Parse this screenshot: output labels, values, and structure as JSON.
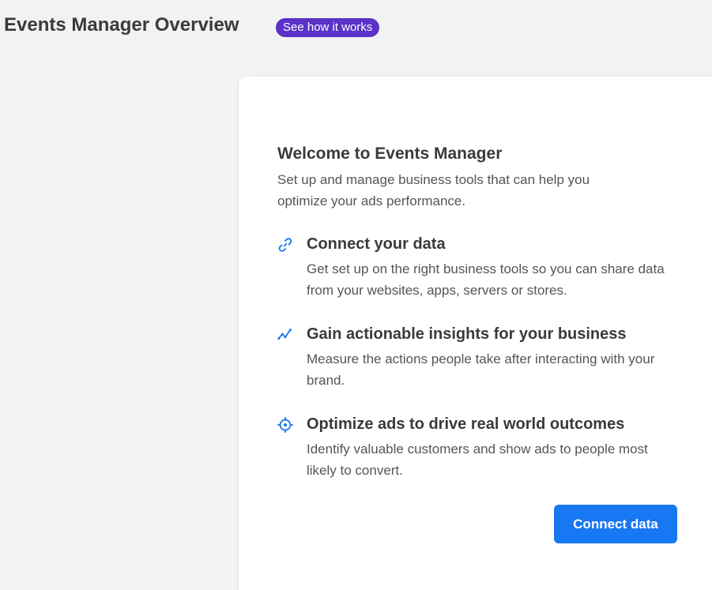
{
  "header": {
    "title": "Events Manager Overview",
    "how_it_works_label": "See how it works"
  },
  "card": {
    "title": "Welcome to Events Manager",
    "description": "Set up and manage business tools that can help you optimize your ads performance.",
    "features": [
      {
        "icon": "link-icon",
        "title": "Connect your data",
        "description": "Get set up on the right business tools so you can share data from your websites, apps, servers or stores."
      },
      {
        "icon": "chart-trend-icon",
        "title": "Gain actionable insights for your business",
        "description": "Measure the actions people take after interacting with your brand."
      },
      {
        "icon": "target-icon",
        "title": "Optimize ads to drive real world outcomes",
        "description": "Identify valuable customers and show ads to people most likely to convert."
      }
    ],
    "connect_button_label": "Connect data"
  },
  "colors": {
    "background": "#f2f2f2",
    "card": "#ffffff",
    "badge": "#5a32c8",
    "primary": "#1877f2",
    "icon": "#1877f2",
    "title_text": "#3a3a3a",
    "body_text": "#555555"
  }
}
